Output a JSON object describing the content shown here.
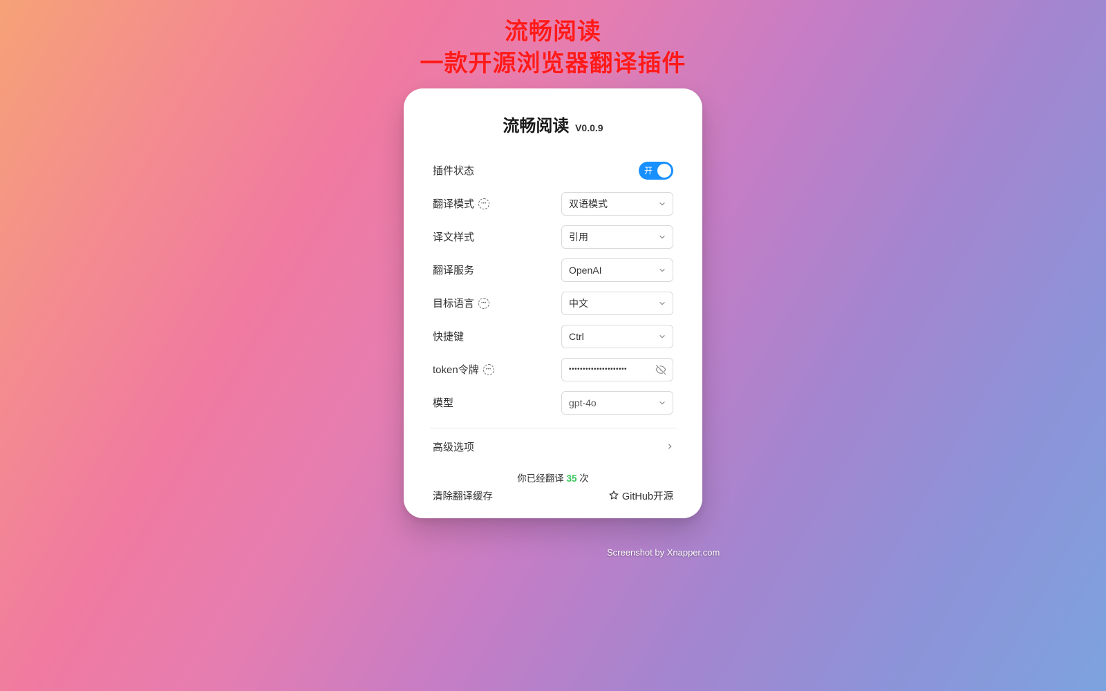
{
  "hero": {
    "line1": "流畅阅读",
    "line2": "一款开源浏览器翻译插件"
  },
  "card": {
    "title": "流畅阅读",
    "version": "V0.0.9",
    "rows": {
      "plugin_state": {
        "label": "插件状态",
        "toggle_on_text": "开",
        "enabled": true
      },
      "mode": {
        "label": "翻译模式",
        "value": "双语模式",
        "has_help": true
      },
      "style": {
        "label": "译文样式",
        "value": "引用"
      },
      "service": {
        "label": "翻译服务",
        "value": "OpenAI"
      },
      "target_lang": {
        "label": "目标语言",
        "value": "中文",
        "has_help": true
      },
      "hotkey": {
        "label": "快捷键",
        "value": "Ctrl"
      },
      "token": {
        "label": "token令牌",
        "masked": "•••••••••••••••••••••",
        "has_help": true
      },
      "model": {
        "label": "模型",
        "value": "gpt-4o"
      }
    },
    "advanced_label": "高级选项",
    "stats_prefix": "你已经翻译 ",
    "stats_count": "35",
    "stats_suffix": " 次",
    "clear_cache": "清除翻译缓存",
    "github": "GitHub开源"
  },
  "credit": "Screenshot by Xnapper.com"
}
